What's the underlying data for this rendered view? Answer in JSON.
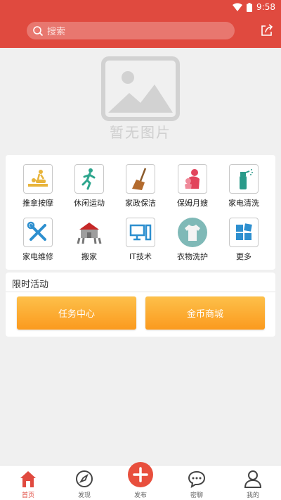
{
  "status": {
    "time": "9:58"
  },
  "search": {
    "placeholder": "搜索"
  },
  "banner": {
    "empty_text": "暂无图片"
  },
  "services": [
    {
      "label": "推拿按摩",
      "icon": "massage-icon"
    },
    {
      "label": "休闲运动",
      "icon": "running-icon"
    },
    {
      "label": "家政保洁",
      "icon": "broom-icon"
    },
    {
      "label": "保姆月嫂",
      "icon": "nanny-icon"
    },
    {
      "label": "家电清洗",
      "icon": "spray-icon"
    },
    {
      "label": "家电维修",
      "icon": "tools-icon"
    },
    {
      "label": "搬家",
      "icon": "moving-house-icon"
    },
    {
      "label": "IT技术",
      "icon": "computer-icon"
    },
    {
      "label": "衣物洗护",
      "icon": "shirt-icon"
    },
    {
      "label": "更多",
      "icon": "more-grid-icon"
    }
  ],
  "activity": {
    "title": "限时活动",
    "task_center": "任务中心",
    "coin_mall": "金币商城"
  },
  "nav": {
    "home": "首页",
    "discover": "发现",
    "publish": "发布",
    "chat": "密聊",
    "mine": "我的"
  },
  "colors": {
    "brand": "#e04a3f",
    "button": "#fb9a1e"
  }
}
